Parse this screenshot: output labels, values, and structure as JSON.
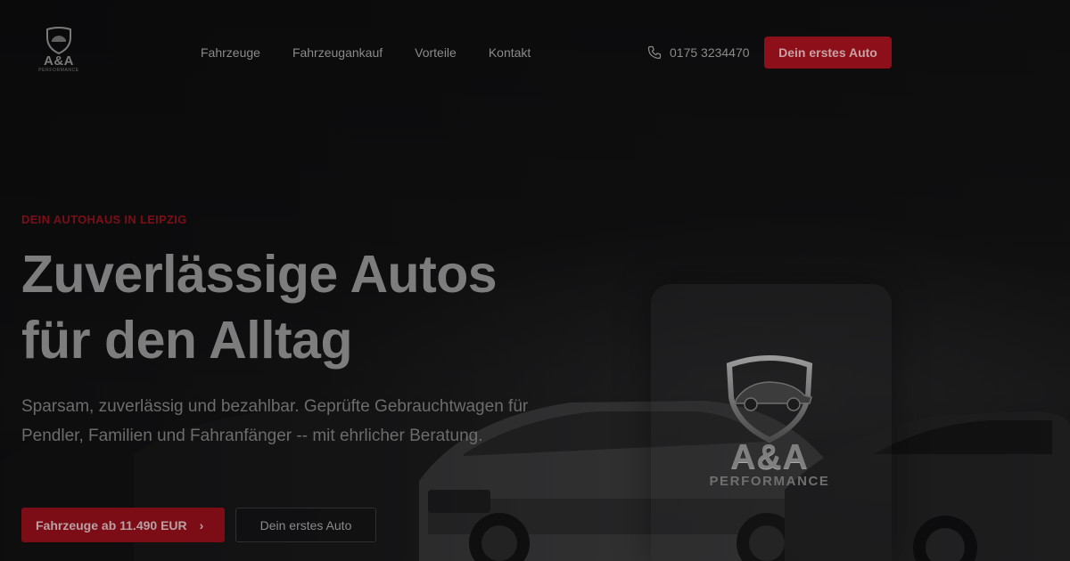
{
  "header": {
    "logo": {
      "word": "A&A",
      "sub": "PERFORMANCE"
    },
    "nav": [
      {
        "label": "Fahrzeuge"
      },
      {
        "label": "Fahrzeugankauf"
      },
      {
        "label": "Vorteile"
      },
      {
        "label": "Kontakt"
      }
    ],
    "phone": {
      "icon": "phone-icon",
      "number": "0175 3234470"
    },
    "cta_label": "Dein erstes Auto"
  },
  "hero": {
    "eyebrow": "DEIN AUTOHAUS IN LEIPZIG",
    "title_line1": "Zuverlässige Autos",
    "title_line2": "für den Alltag",
    "lead": "Sparsam, zuverlässig und bezahlbar. Geprüfte Gebrauchtwagen für Pendler, Familien und Fahranfänger -- mit ehrlicher Beratung.",
    "primary_button": {
      "label": "Fahrzeuge ab 11.490 EUR",
      "icon": "chevron-right-icon"
    },
    "secondary_button": {
      "label": "Dein erstes Auto"
    }
  },
  "emblem": {
    "word": "A&A",
    "sub": "PERFORMANCE"
  },
  "colors": {
    "accent": "#8c0f19",
    "background": "#0b0b0c",
    "eyebrow": "#7b0e17"
  }
}
